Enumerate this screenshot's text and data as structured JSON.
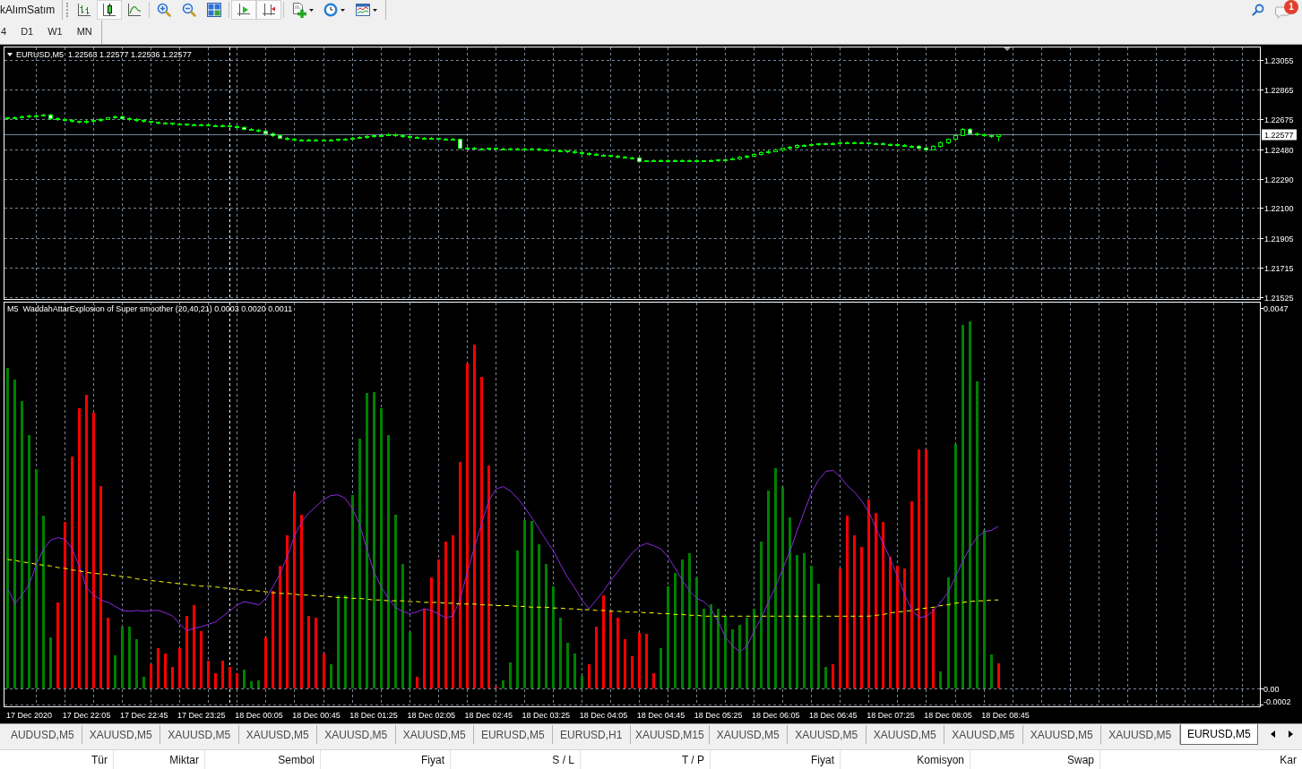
{
  "toolbar": {
    "label": "kAlımSatım",
    "groups": [
      [
        {
          "kind": "bars",
          "pressed": false,
          "dropdown": false
        },
        {
          "kind": "candles",
          "pressed": true,
          "dropdown": false
        },
        {
          "kind": "line",
          "pressed": false,
          "dropdown": false
        }
      ],
      [
        {
          "kind": "zoom_in",
          "pressed": false,
          "dropdown": false
        },
        {
          "kind": "zoom_out",
          "pressed": false,
          "dropdown": false
        },
        {
          "kind": "tile_windows",
          "pressed": false,
          "dropdown": false
        }
      ],
      [
        {
          "kind": "auto_scroll",
          "pressed": true,
          "dropdown": false
        },
        {
          "kind": "chart_shift",
          "pressed": true,
          "dropdown": false
        }
      ],
      [
        {
          "kind": "new_indicator",
          "pressed": false,
          "dropdown": true
        },
        {
          "kind": "periods",
          "pressed": false,
          "dropdown": true
        },
        {
          "kind": "templates",
          "pressed": false,
          "dropdown": true
        }
      ]
    ],
    "notification_count": "1"
  },
  "timeframes": [
    {
      "label": "4",
      "selected": false
    },
    {
      "label": "D1",
      "selected": false
    },
    {
      "label": "W1",
      "selected": false
    },
    {
      "label": "MN",
      "selected": false
    }
  ],
  "chart": {
    "chart_data": [
      {
        "type": "candlestick",
        "title": "EURUSD,M5  1.22563 1.22577 1.22536 1.22577",
        "tick_labels": "y",
        "ylim": [
          1.2151,
          1.2314
        ],
        "yticks": [
          {
            "value": 1.23055,
            "label": "1.23055"
          },
          {
            "value": 1.22865,
            "label": "1.22865"
          },
          {
            "value": 1.22675,
            "label": "1.22675"
          },
          {
            "value": 1.2248,
            "label": "1.22480"
          },
          {
            "value": 1.2229,
            "label": "1.22290"
          },
          {
            "value": 1.221,
            "label": "1.22100"
          },
          {
            "value": 1.21905,
            "label": "1.21905"
          },
          {
            "value": 1.21715,
            "label": "1.21715"
          },
          {
            "value": 1.21525,
            "label": "1.21525"
          }
        ],
        "grid": true,
        "color": "#00ff00",
        "ref_lines": [
          {
            "axis": "y",
            "value": 1.22577,
            "label": "1.22577",
            "color": "#778899"
          }
        ],
        "ohlc": [
          [
            1.2268,
            1.22689,
            1.22676,
            1.22684
          ],
          [
            1.22684,
            1.22693,
            1.2268,
            1.22688
          ],
          [
            1.22688,
            1.22698,
            1.22684,
            1.22693
          ],
          [
            1.22693,
            1.22702,
            1.22689,
            1.22697
          ],
          [
            1.22697,
            1.22705,
            1.22693,
            1.227
          ],
          [
            1.227,
            1.22707,
            1.22696,
            1.22702
          ],
          [
            1.22702,
            1.22707,
            1.22676,
            1.2268
          ],
          [
            1.2268,
            1.22685,
            1.2267,
            1.22674
          ],
          [
            1.22674,
            1.22679,
            1.22664,
            1.22668
          ],
          [
            1.22668,
            1.22673,
            1.22657,
            1.22661
          ],
          [
            1.22661,
            1.22666,
            1.22651,
            1.22655
          ],
          [
            1.22655,
            1.22667,
            1.22651,
            1.22662
          ],
          [
            1.22662,
            1.22675,
            1.22658,
            1.2267
          ],
          [
            1.2267,
            1.22682,
            1.22666,
            1.22677
          ],
          [
            1.22677,
            1.22689,
            1.22673,
            1.22684
          ],
          [
            1.22684,
            1.22695,
            1.2268,
            1.2269
          ],
          [
            1.2269,
            1.22695,
            1.22678,
            1.22682
          ],
          [
            1.22682,
            1.22687,
            1.22671,
            1.22675
          ],
          [
            1.22675,
            1.2268,
            1.22664,
            1.22668
          ],
          [
            1.22668,
            1.22673,
            1.22657,
            1.22661
          ],
          [
            1.22661,
            1.22666,
            1.22651,
            1.22655
          ],
          [
            1.22655,
            1.2266,
            1.22648,
            1.22652
          ],
          [
            1.22652,
            1.22657,
            1.22645,
            1.22649
          ],
          [
            1.22649,
            1.22654,
            1.22642,
            1.22646
          ],
          [
            1.22646,
            1.22651,
            1.22639,
            1.22643
          ],
          [
            1.22643,
            1.22648,
            1.22636,
            1.2264
          ],
          [
            1.2264,
            1.22645,
            1.22635,
            1.22639
          ],
          [
            1.22639,
            1.22644,
            1.22634,
            1.22638
          ],
          [
            1.22638,
            1.22643,
            1.22633,
            1.22637
          ],
          [
            1.22637,
            1.22642,
            1.22632,
            1.22636
          ],
          [
            1.22636,
            1.22641,
            1.22631,
            1.22635
          ],
          [
            1.22635,
            1.2264,
            1.22624,
            1.22628
          ],
          [
            1.22628,
            1.22633,
            1.22617,
            1.22621
          ],
          [
            1.22621,
            1.22626,
            1.2261,
            1.22614
          ],
          [
            1.22614,
            1.22619,
            1.22603,
            1.22607
          ],
          [
            1.22607,
            1.22612,
            1.22596,
            1.226
          ],
          [
            1.226,
            1.22605,
            1.22581,
            1.22585
          ],
          [
            1.22585,
            1.2259,
            1.22566,
            1.2257
          ],
          [
            1.2257,
            1.22575,
            1.22551,
            1.22555
          ],
          [
            1.22555,
            1.2256,
            1.22543,
            1.22547
          ],
          [
            1.22547,
            1.22552,
            1.22536,
            1.2254
          ],
          [
            1.2254,
            1.22547,
            1.22536,
            1.22542
          ],
          [
            1.22542,
            1.22547,
            1.22534,
            1.22538
          ],
          [
            1.22538,
            1.22546,
            1.22534,
            1.22541
          ],
          [
            1.22541,
            1.22546,
            1.22535,
            1.22539
          ],
          [
            1.22539,
            1.22545,
            1.22535,
            1.2254
          ],
          [
            1.2254,
            1.2255,
            1.22536,
            1.22545
          ],
          [
            1.22545,
            1.22555,
            1.22541,
            1.2255
          ],
          [
            1.2255,
            1.2256,
            1.22546,
            1.22555
          ],
          [
            1.22555,
            1.22565,
            1.22551,
            1.2256
          ],
          [
            1.2256,
            1.2257,
            1.22556,
            1.22565
          ],
          [
            1.22565,
            1.22573,
            1.22561,
            1.22568
          ],
          [
            1.22568,
            1.22577,
            1.22564,
            1.22572
          ],
          [
            1.22572,
            1.2258,
            1.22568,
            1.22575
          ],
          [
            1.22575,
            1.2258,
            1.22566,
            1.2257
          ],
          [
            1.2257,
            1.22575,
            1.22561,
            1.22565
          ],
          [
            1.22565,
            1.2257,
            1.22556,
            1.2256
          ],
          [
            1.2256,
            1.22565,
            1.22551,
            1.22555
          ],
          [
            1.22555,
            1.2256,
            1.22549,
            1.22553
          ],
          [
            1.22553,
            1.22558,
            1.22547,
            1.22551
          ],
          [
            1.22551,
            1.22556,
            1.22545,
            1.22549
          ],
          [
            1.22549,
            1.22554,
            1.22543,
            1.22547
          ],
          [
            1.22547,
            1.22552,
            1.22541,
            1.22545
          ],
          [
            1.22545,
            1.2255,
            1.22486,
            1.2249
          ],
          [
            1.2249,
            1.22495,
            1.22484,
            1.22488
          ],
          [
            1.22488,
            1.22493,
            1.22482,
            1.22486
          ],
          [
            1.22486,
            1.22491,
            1.22481,
            1.22485
          ],
          [
            1.22485,
            1.22492,
            1.22481,
            1.22487
          ],
          [
            1.22487,
            1.22492,
            1.2248,
            1.22484
          ],
          [
            1.22484,
            1.22491,
            1.2248,
            1.22486
          ],
          [
            1.22486,
            1.22491,
            1.22481,
            1.22485
          ],
          [
            1.22485,
            1.2249,
            1.22479,
            1.22483
          ],
          [
            1.22483,
            1.2249,
            1.22479,
            1.22485
          ],
          [
            1.22485,
            1.2249,
            1.22478,
            1.22482
          ],
          [
            1.22482,
            1.22487,
            1.22475,
            1.22479
          ],
          [
            1.22479,
            1.22484,
            1.22472,
            1.22476
          ],
          [
            1.22476,
            1.22481,
            1.22469,
            1.22473
          ],
          [
            1.22473,
            1.22478,
            1.22466,
            1.2247
          ],
          [
            1.2247,
            1.22475,
            1.22461,
            1.22465
          ],
          [
            1.22465,
            1.2247,
            1.22456,
            1.2246
          ],
          [
            1.2246,
            1.22465,
            1.22451,
            1.22455
          ],
          [
            1.22455,
            1.2246,
            1.22446,
            1.2245
          ],
          [
            1.2245,
            1.22455,
            1.22441,
            1.22445
          ],
          [
            1.22445,
            1.2245,
            1.22437,
            1.22441
          ],
          [
            1.22441,
            1.22446,
            1.22433,
            1.22437
          ],
          [
            1.22437,
            1.22442,
            1.22429,
            1.22433
          ],
          [
            1.22433,
            1.22438,
            1.22425,
            1.22429
          ],
          [
            1.22429,
            1.22434,
            1.22421,
            1.22425
          ],
          [
            1.22425,
            1.2243,
            1.22401,
            1.22405
          ],
          [
            1.22405,
            1.22411,
            1.22401,
            1.22406
          ],
          [
            1.22406,
            1.22412,
            1.22402,
            1.22407
          ],
          [
            1.22407,
            1.22413,
            1.22403,
            1.22408
          ],
          [
            1.22408,
            1.22414,
            1.22404,
            1.22409
          ],
          [
            1.22409,
            1.22415,
            1.22405,
            1.2241
          ],
          [
            1.2241,
            1.22415,
            1.22405,
            1.22409
          ],
          [
            1.22409,
            1.22414,
            1.22403,
            1.22407
          ],
          [
            1.22407,
            1.22412,
            1.22402,
            1.22406
          ],
          [
            1.22406,
            1.22411,
            1.22401,
            1.22405
          ],
          [
            1.22405,
            1.22414,
            1.22401,
            1.22409
          ],
          [
            1.22409,
            1.22417,
            1.22405,
            1.22412
          ],
          [
            1.22412,
            1.22421,
            1.22408,
            1.22416
          ],
          [
            1.22416,
            1.22425,
            1.22412,
            1.2242
          ],
          [
            1.2242,
            1.22435,
            1.22416,
            1.2243
          ],
          [
            1.2243,
            1.22445,
            1.22426,
            1.2244
          ],
          [
            1.2244,
            1.22455,
            1.22436,
            1.2245
          ],
          [
            1.2245,
            1.22465,
            1.22446,
            1.2246
          ],
          [
            1.2246,
            1.22474,
            1.22456,
            1.22469
          ],
          [
            1.22469,
            1.22483,
            1.22465,
            1.22478
          ],
          [
            1.22478,
            1.22492,
            1.22474,
            1.22487
          ],
          [
            1.22487,
            1.22501,
            1.22483,
            1.22496
          ],
          [
            1.22496,
            1.2251,
            1.22492,
            1.22505
          ],
          [
            1.22505,
            1.22514,
            1.22501,
            1.22509
          ],
          [
            1.22509,
            1.22518,
            1.22505,
            1.22513
          ],
          [
            1.22513,
            1.22521,
            1.22509,
            1.22516
          ],
          [
            1.22516,
            1.22525,
            1.22512,
            1.2252
          ],
          [
            1.2252,
            1.22526,
            1.22516,
            1.22521
          ],
          [
            1.22521,
            1.22528,
            1.22517,
            1.22523
          ],
          [
            1.22523,
            1.22529,
            1.22519,
            1.22524
          ],
          [
            1.22524,
            1.2253,
            1.2252,
            1.22525
          ],
          [
            1.22525,
            1.2253,
            1.22518,
            1.22522
          ],
          [
            1.22522,
            1.22527,
            1.22516,
            1.2252
          ],
          [
            1.2252,
            1.22525,
            1.22513,
            1.22517
          ],
          [
            1.22517,
            1.22522,
            1.22511,
            1.22515
          ],
          [
            1.22515,
            1.2252,
            1.22507,
            1.22511
          ],
          [
            1.22511,
            1.22516,
            1.22503,
            1.22507
          ],
          [
            1.22507,
            1.22512,
            1.225,
            1.22504
          ],
          [
            1.22504,
            1.22509,
            1.22496,
            1.225
          ],
          [
            1.225,
            1.22505,
            1.22486,
            1.2249
          ],
          [
            1.2249,
            1.22495,
            1.22476,
            1.2248
          ],
          [
            1.2248,
            1.22507,
            1.22476,
            1.22502
          ],
          [
            1.22502,
            1.22528,
            1.22498,
            1.22523
          ],
          [
            1.22523,
            1.2255,
            1.22519,
            1.22545
          ],
          [
            1.22545,
            1.22577,
            1.22541,
            1.22572
          ],
          [
            1.22572,
            1.22615,
            1.22568,
            1.2261
          ],
          [
            1.2261,
            1.22615,
            1.22581,
            1.22585
          ],
          [
            1.22585,
            1.2259,
            1.22571,
            1.22575
          ],
          [
            1.22575,
            1.2258,
            1.22566,
            1.2257
          ],
          [
            1.2257,
            1.22575,
            1.22559,
            1.22563
          ],
          [
            1.22563,
            1.22577,
            1.22536,
            1.22577
          ],
          null,
          null,
          null,
          null,
          null,
          null,
          null,
          null,
          null,
          null,
          null,
          null,
          null,
          null,
          null,
          null,
          null,
          null,
          null,
          null,
          null,
          null,
          null,
          null,
          null,
          null,
          null,
          null,
          null,
          null,
          null,
          null,
          null,
          null,
          null,
          null
        ]
      },
      {
        "type": "bar",
        "title": "M5  WaddahAttarExplosion of Super smoother (20,40,21) 0.0003 0.0020 0.0011",
        "ylim": [
          -0.00023,
          0.00477
        ],
        "yticks": [
          {
            "value": 0.0047,
            "label": "0.0047"
          },
          {
            "value": 0,
            "label": "0.00"
          },
          {
            "value": -0.0002,
            "label": "-0.0002"
          }
        ],
        "grid": true,
        "categories": [
          null,
          null,
          null,
          "17 Dec 2020",
          null,
          null,
          null,
          null,
          null,
          null,
          null,
          "17 Dec 22:05",
          null,
          null,
          null,
          null,
          null,
          null,
          null,
          "17 Dec 22:45",
          null,
          null,
          null,
          null,
          null,
          null,
          null,
          "17 Dec 23:25",
          null,
          null,
          null,
          null,
          null,
          null,
          null,
          "18 Dec 00:05",
          null,
          null,
          null,
          null,
          null,
          null,
          null,
          "18 Dec 00:45",
          null,
          null,
          null,
          null,
          null,
          null,
          null,
          "18 Dec 01:25",
          null,
          null,
          null,
          null,
          null,
          null,
          null,
          "18 Dec 02:05",
          null,
          null,
          null,
          null,
          null,
          null,
          null,
          "18 Dec 02:45",
          null,
          null,
          null,
          null,
          null,
          null,
          null,
          "18 Dec 03:25",
          null,
          null,
          null,
          null,
          null,
          null,
          null,
          "18 Dec 04:05",
          null,
          null,
          null,
          null,
          null,
          null,
          null,
          "18 Dec 04:45",
          null,
          null,
          null,
          null,
          null,
          null,
          null,
          "18 Dec 05:25",
          null,
          null,
          null,
          null,
          null,
          null,
          null,
          "18 Dec 06:05",
          null,
          null,
          null,
          null,
          null,
          null,
          null,
          "18 Dec 06:45",
          null,
          null,
          null,
          null,
          null,
          null,
          null,
          "18 Dec 07:25",
          null,
          null,
          null,
          null,
          null,
          null,
          null,
          "18 Dec 08:05",
          null,
          null,
          null,
          null,
          null,
          null,
          null,
          "18 Dec 08:45",
          null,
          null,
          null,
          null,
          null,
          null,
          null,
          null,
          null,
          null,
          null,
          null,
          null,
          null,
          null,
          null,
          null,
          null,
          null,
          null,
          null,
          null,
          null,
          null,
          null,
          null,
          null,
          null,
          null,
          null,
          null,
          null,
          null,
          null,
          null
        ],
        "series": [
          {
            "color": "#008000",
            "values": [
              0.00396,
              0.00381,
              0.00355,
              0.00313,
              0.00271,
              0.00213,
              0.00063,
              null,
              null,
              null,
              null,
              null,
              null,
              null,
              null,
              0.00041,
              0.00076,
              0.00076,
              0.0006,
              0.00014,
              null,
              null,
              null,
              null,
              null,
              null,
              null,
              null,
              null,
              null,
              null,
              null,
              null,
              0.00023,
              8e-05,
              0.0001,
              null,
              null,
              null,
              null,
              null,
              null,
              null,
              null,
              null,
              0.0003,
              0.00115,
              0.00115,
              0.00239,
              0.00308,
              0.00365,
              0.00366,
              0.00346,
              0.00313,
              0.00214,
              0.00153,
              0.00069,
              null,
              null,
              null,
              null,
              null,
              null,
              null,
              null,
              null,
              null,
              null,
              null,
              0.0001,
              0.00032,
              0.0017,
              0.00208,
              0.00206,
              0.00178,
              0.00153,
              0.00126,
              0.00087,
              0.00056,
              0.00043,
              0.00015,
              null,
              null,
              null,
              null,
              null,
              null,
              null,
              null,
              null,
              null,
              0.00049,
              0.00126,
              0.00142,
              0.00159,
              0.00167,
              0.00137,
              0.00098,
              0.00104,
              0.00098,
              0.00089,
              0.00073,
              0.00078,
              0.00087,
              0.00098,
              0.00181,
              0.00244,
              0.00272,
              0.00249,
              0.00211,
              0.00164,
              0.00167,
              0.00151,
              0.00129,
              0.00026,
              null,
              null,
              null,
              null,
              null,
              null,
              null,
              null,
              null,
              null,
              null,
              null,
              null,
              null,
              null,
              0.00021,
              0.00137,
              0.00302,
              0.00449,
              0.00453,
              0.00379,
              0.00195,
              0.00042,
              null,
              null,
              null,
              null,
              null,
              null,
              null,
              null,
              null,
              null,
              null,
              null,
              null,
              null,
              null,
              null,
              null,
              null,
              null,
              null,
              null,
              null,
              null,
              null,
              null,
              null,
              null,
              null,
              null,
              null,
              null,
              null,
              null,
              null,
              null,
              null,
              null
            ]
          },
          {
            "color": "#ff0000",
            "values": [
              null,
              null,
              null,
              null,
              null,
              null,
              null,
              0.00106,
              0.00205,
              0.00286,
              0.00346,
              0.00363,
              0.0034,
              0.0025,
              0.00087,
              null,
              null,
              null,
              null,
              null,
              0.00029,
              0.0005,
              0.00043,
              0.00026,
              0.00049,
              0.00089,
              0.00103,
              0.00071,
              0.00034,
              0.00019,
              0.00034,
              0.00026,
              0.00019,
              null,
              null,
              null,
              0.00063,
              0.0012,
              0.00151,
              0.00189,
              0.00242,
              0.00214,
              0.00089,
              0.00087,
              0.00043,
              null,
              null,
              null,
              null,
              null,
              null,
              null,
              null,
              null,
              null,
              null,
              null,
              0.00014,
              0.00098,
              0.00137,
              0.00159,
              0.00181,
              0.00189,
              0.0028,
              0.00401,
              0.00424,
              0.00385,
              0.00275,
              2e-05,
              null,
              null,
              null,
              null,
              null,
              null,
              null,
              null,
              null,
              null,
              null,
              null,
              0.0003,
              0.00076,
              0.00115,
              0.00096,
              0.00087,
              0.0006,
              0.0004,
              0.00068,
              0.00067,
              0.00019,
              null,
              null,
              null,
              null,
              null,
              null,
              null,
              null,
              null,
              null,
              null,
              null,
              null,
              null,
              null,
              null,
              null,
              null,
              null,
              null,
              null,
              null,
              null,
              null,
              0.0003,
              0.00148,
              0.00213,
              0.00189,
              0.00175,
              0.00233,
              0.00217,
              0.00205,
              0.00162,
              0.00151,
              0.00148,
              0.00231,
              0.00295,
              0.00295,
              0.00098,
              null,
              null,
              null,
              null,
              null,
              null,
              null,
              null,
              0.00031,
              null,
              null,
              null,
              null,
              null,
              null,
              null,
              null,
              null,
              null,
              null,
              null,
              null,
              null,
              null,
              null,
              null,
              null,
              null,
              null,
              null,
              null,
              null,
              null,
              null,
              null,
              null,
              null,
              null,
              null,
              null,
              null,
              null,
              null,
              null,
              null
            ]
          },
          {
            "type": "line",
            "color": "#8a2be2",
            "values": [
              0.00124,
              0.00104,
              0.00115,
              0.00128,
              0.00153,
              0.00172,
              0.00183,
              0.00186,
              0.00184,
              0.00172,
              0.0015,
              0.00124,
              0.00115,
              0.00109,
              0.00106,
              0.00101,
              0.00096,
              0.00095,
              0.00096,
              0.00095,
              0.00096,
              0.00096,
              0.00093,
              0.00089,
              0.00079,
              0.00071,
              0.00074,
              0.00076,
              0.00079,
              0.00082,
              0.00089,
              0.00096,
              0.00103,
              0.00107,
              0.00105,
              0.00103,
              0.00111,
              0.00126,
              0.00142,
              0.00164,
              0.00189,
              0.00206,
              0.00217,
              0.00225,
              0.00233,
              0.00238,
              0.00239,
              0.00235,
              0.00222,
              0.00203,
              0.00173,
              0.00144,
              0.00126,
              0.00111,
              0.001,
              0.00095,
              0.00092,
              0.00094,
              0.00098,
              0.00096,
              0.00092,
              0.00087,
              0.00089,
              0.00109,
              0.00142,
              0.00173,
              0.00203,
              0.00231,
              0.00246,
              0.00249,
              0.00244,
              0.00235,
              0.00224,
              0.00211,
              0.00197,
              0.00183,
              0.0017,
              0.00153,
              0.00137,
              0.00124,
              0.00109,
              0.00098,
              0.00109,
              0.0012,
              0.00133,
              0.00144,
              0.00156,
              0.00167,
              0.00175,
              0.00179,
              0.00176,
              0.00172,
              0.00162,
              0.00148,
              0.00133,
              0.0012,
              0.00111,
              0.00107,
              0.00098,
              0.00082,
              0.00063,
              0.00052,
              0.00045,
              0.00052,
              0.00071,
              0.00087,
              0.00107,
              0.00126,
              0.00148,
              0.0017,
              0.00195,
              0.00219,
              0.00242,
              0.00258,
              0.00268,
              0.00269,
              0.00261,
              0.0025,
              0.00242,
              0.00231,
              0.00217,
              0.00197,
              0.00178,
              0.00159,
              0.00137,
              0.00115,
              0.00096,
              0.00087,
              0.00089,
              0.00096,
              0.00107,
              0.00118,
              0.00137,
              0.00156,
              0.00173,
              0.00186,
              0.00193,
              0.00195,
              0.002,
              null,
              null,
              null,
              null,
              null,
              null,
              null,
              null,
              null,
              null,
              null,
              null,
              null,
              null,
              null,
              null,
              null,
              null,
              null,
              null,
              null,
              null,
              null,
              null,
              null,
              null,
              null,
              null,
              null,
              null,
              null,
              null,
              null,
              null,
              null,
              null
            ]
          },
          {
            "type": "line",
            "color": "#ffff00",
            "line_style": "dashed",
            "values": [
              0.00159,
              0.00158,
              0.00156,
              0.00155,
              0.00153,
              0.00152,
              0.00151,
              0.00149,
              0.00148,
              0.00146,
              0.00145,
              0.00143,
              0.00142,
              0.00141,
              0.0014,
              0.00139,
              0.00138,
              0.00137,
              0.00135,
              0.00134,
              0.00133,
              0.00132,
              0.00131,
              0.0013,
              0.00129,
              0.00128,
              0.00127,
              0.00126,
              0.00126,
              0.00125,
              0.00124,
              0.00123,
              0.00122,
              0.00121,
              0.00121,
              0.0012,
              0.00119,
              0.00118,
              0.00117,
              0.00117,
              0.00116,
              0.00115,
              0.00115,
              0.00114,
              0.00114,
              0.00113,
              0.00112,
              0.00112,
              0.00111,
              0.00111,
              0.0011,
              0.00109,
              0.00109,
              0.00108,
              0.00108,
              0.00108,
              0.00107,
              0.00107,
              0.00106,
              0.00106,
              0.00106,
              0.00105,
              0.00105,
              0.00104,
              0.00104,
              0.00104,
              0.00103,
              0.00103,
              0.00102,
              0.00102,
              0.00102,
              0.00101,
              0.00101,
              0.001,
              0.001,
              0.001,
              0.00099,
              0.00099,
              0.00098,
              0.00098,
              0.00097,
              0.00097,
              0.00096,
              0.00096,
              0.00095,
              0.00095,
              0.00094,
              0.00094,
              0.00094,
              0.00093,
              0.00093,
              0.00092,
              0.00092,
              0.00091,
              0.00091,
              0.0009,
              0.0009,
              0.00089,
              0.00089,
              0.00089,
              0.00089,
              0.00089,
              0.00089,
              0.00089,
              0.00089,
              0.00089,
              0.00089,
              0.00089,
              0.00089,
              0.00089,
              0.00089,
              0.00089,
              0.00089,
              0.00089,
              0.00089,
              0.00089,
              0.00089,
              0.00089,
              0.00089,
              0.00089,
              0.00089,
              0.0009,
              0.00091,
              0.00093,
              0.00094,
              0.00095,
              0.00096,
              0.00098,
              0.00099,
              0.001,
              0.00102,
              0.00103,
              0.00105,
              0.00106,
              0.00107,
              0.00108,
              0.00108,
              0.00109,
              0.00109,
              null,
              null,
              null,
              null,
              null,
              null,
              null,
              null,
              null,
              null,
              null,
              null,
              null,
              null,
              null,
              null,
              null,
              null,
              null,
              null,
              null,
              null,
              null,
              null,
              null,
              null,
              null,
              null,
              null,
              null,
              null,
              null,
              null,
              null,
              null,
              null
            ]
          }
        ]
      }
    ]
  },
  "chart_tabs": [
    {
      "label": "AUDUSD,M5",
      "selected": false
    },
    {
      "label": "XAUUSD,M5",
      "selected": false
    },
    {
      "label": "XAUUSD,M5",
      "selected": false
    },
    {
      "label": "XAUUSD,M5",
      "selected": false
    },
    {
      "label": "XAUUSD,M5",
      "selected": false
    },
    {
      "label": "XAUUSD,M5",
      "selected": false
    },
    {
      "label": "EURUSD,M5",
      "selected": false
    },
    {
      "label": "EURUSD,H1",
      "selected": false
    },
    {
      "label": "XAUUSD,M15",
      "selected": false
    },
    {
      "label": "XAUUSD,M5",
      "selected": false
    },
    {
      "label": "XAUUSD,M5",
      "selected": false
    },
    {
      "label": "XAUUSD,M5",
      "selected": false
    },
    {
      "label": "XAUUSD,M5",
      "selected": false
    },
    {
      "label": "XAUUSD,M5",
      "selected": false
    },
    {
      "label": "XAUUSD,M5",
      "selected": false
    },
    {
      "label": "EURUSD,M5",
      "selected": true
    }
  ],
  "terminal": {
    "columns": [
      "Tür",
      "Miktar",
      "Sembol",
      "Fiyat",
      "S / L",
      "T / P",
      "Fiyat",
      "Komisyon",
      "Swap",
      "Kar"
    ]
  }
}
